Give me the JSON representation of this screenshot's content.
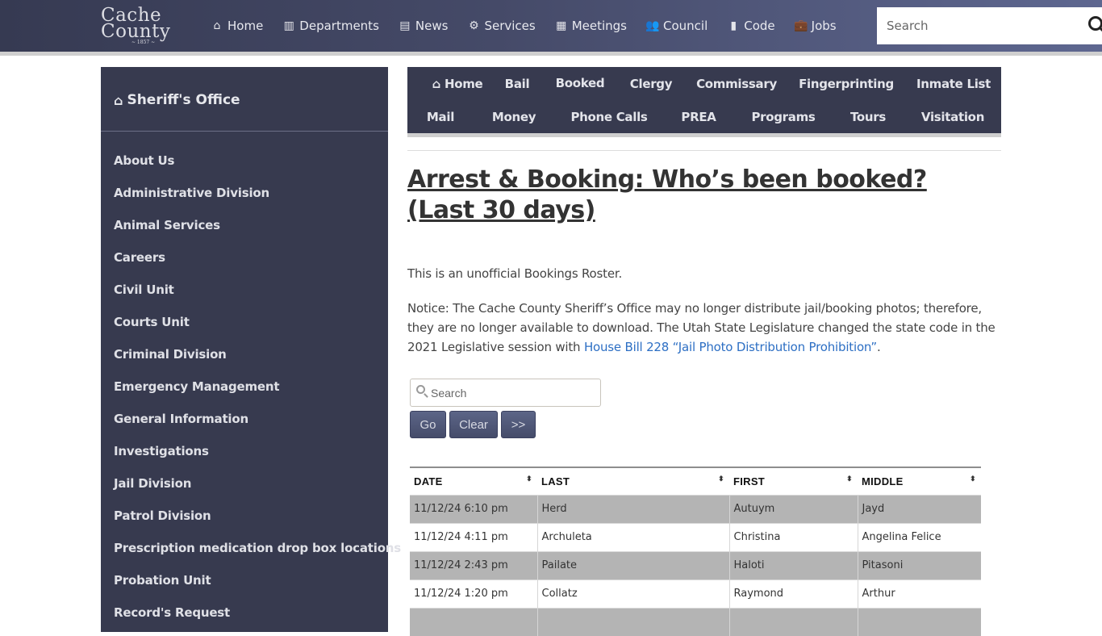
{
  "site": {
    "logo_line1": "Cache",
    "logo_line2": "County",
    "logo_year": "~ 1857 ~"
  },
  "topnav": {
    "items": [
      {
        "label": "Home",
        "icon": "home-icon",
        "glyph": "⌂"
      },
      {
        "label": "Departments",
        "icon": "map-icon",
        "glyph": "▥"
      },
      {
        "label": "News",
        "icon": "newspaper-icon",
        "glyph": "▤"
      },
      {
        "label": "Services",
        "icon": "gear-icon",
        "glyph": "⚙"
      },
      {
        "label": "Meetings",
        "icon": "calendar-icon",
        "glyph": "▦"
      },
      {
        "label": "Council",
        "icon": "users-icon",
        "glyph": "👥"
      },
      {
        "label": "Code",
        "icon": "book-icon",
        "glyph": "▮"
      },
      {
        "label": "Jobs",
        "icon": "briefcase-icon",
        "glyph": "💼"
      }
    ],
    "search_placeholder": "Search"
  },
  "sidebar": {
    "title": "Sheriff's Office",
    "title_glyph": "⌂",
    "items": [
      "About Us",
      "Administrative Division",
      "Animal Services",
      "Careers",
      "Civil Unit",
      "Courts Unit",
      "Criminal Division",
      "Emergency Management",
      "General Information",
      "Investigations",
      "Jail Division",
      "Patrol Division",
      "Prescription medication drop box locations",
      "Probation Unit",
      "Record's Request"
    ]
  },
  "subnav": {
    "home_glyph": "⌂",
    "row1": [
      "Home",
      "Bail",
      "Booked",
      "Clergy",
      "Commissary",
      "Fingerprinting",
      "Inmate List"
    ],
    "row2": [
      "Mail",
      "Money",
      "Phone Calls",
      "PREA",
      "Programs",
      "Tours",
      "Visitation"
    ]
  },
  "main": {
    "title": "Arrest & Booking: Who’s been booked? (Last 30 days)",
    "intro": "This is an unofficial Bookings Roster.",
    "notice_text": "Notice: The Cache County Sheriff’s Office may no longer distribute jail/booking photos; therefore, they are no longer available to download. The Utah State Legislature changed the state code in the 2021 Legislative session with ",
    "notice_link": "House Bill 228 “Jail Photo Distribution Prohibition”",
    "notice_end": "."
  },
  "roster": {
    "search_placeholder": "Search",
    "go_label": "Go",
    "clear_label": "Clear",
    "next_label": ">>",
    "columns": [
      "DATE",
      "LAST",
      "FIRST",
      "MIDDLE"
    ],
    "sort_glyph": "⬍",
    "rows": [
      [
        "11/12/24 6:10 pm",
        "Herd",
        "Autuym",
        "Jayd"
      ],
      [
        "11/12/24 4:11 pm",
        "Archuleta",
        "Christina",
        "Angelina Felice"
      ],
      [
        "11/12/24 2:43 pm",
        "Pailate",
        "Haloti",
        "Pitasoni"
      ],
      [
        "11/12/24 1:20 pm",
        "Collatz",
        "Raymond",
        "Arthur"
      ],
      [
        "",
        "",
        "",
        ""
      ]
    ]
  },
  "colors": {
    "nav_dark": "#373a4f",
    "link_blue": "#2d6fc4",
    "row_stripe": "#b4b4b4",
    "button": "#4f5779"
  }
}
